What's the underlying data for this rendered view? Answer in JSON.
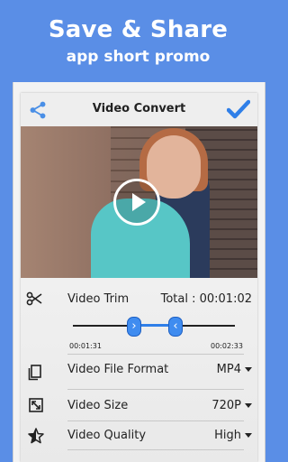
{
  "promo": {
    "title": "Save & Share",
    "subtitle": "app short promo"
  },
  "app": {
    "title": "Video Convert"
  },
  "trim": {
    "label": "Video Trim",
    "total": "Total : 00:01:02",
    "start_time": "00:01:31",
    "end_time": "00:02:33",
    "handle_left_glyph": "›",
    "handle_right_glyph": "‹"
  },
  "settings": [
    {
      "label": "Video File Format",
      "value": "MP4",
      "icon": "file-copy-icon"
    },
    {
      "label": "Video Size",
      "value": "720P",
      "icon": "resize-icon"
    },
    {
      "label": "Video Quality",
      "value": "High",
      "icon": "star-icon"
    }
  ],
  "colors": {
    "background": "#5a8ee6",
    "accent": "#2f7fe8",
    "share_icon": "#4a8fe6"
  }
}
